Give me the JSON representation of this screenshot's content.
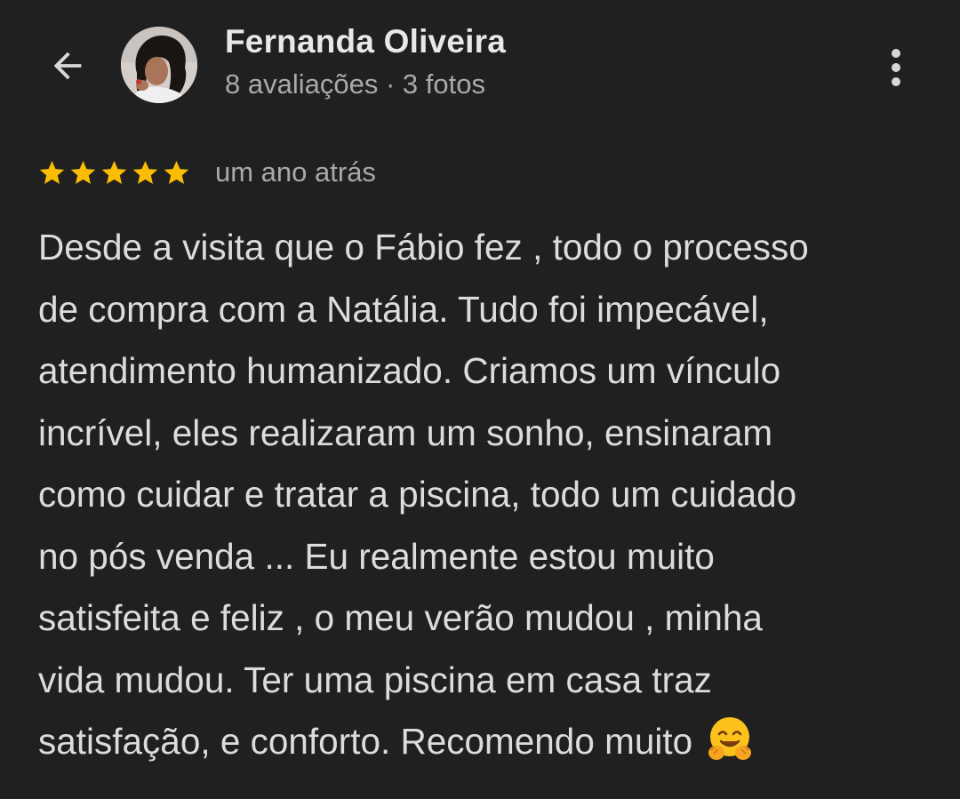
{
  "header": {
    "name": "Fernanda Oliveira",
    "subtitle": "8 avaliações · 3 fotos"
  },
  "icons": {
    "back": "arrow-back-icon",
    "more": "more-vertical-icon",
    "star": "star-icon",
    "emoji": "hugging-face-emoji"
  },
  "review": {
    "rating": 5,
    "rating_max": 5,
    "time": "um ano atrás",
    "lines": [
      "Desde a visita que o Fábio fez , todo o processo",
      "de compra com a Natália. Tudo foi impecável,",
      "atendimento humanizado. Criamos um vínculo",
      "incrível, eles realizaram um sonho, ensinaram",
      "como cuidar e tratar a piscina, todo um cuidado",
      "no pós venda ... Eu realmente estou muito",
      "satisfeita e feliz , o meu verão mudou , minha",
      "vida mudou. Ter uma piscina em casa traz",
      "satisfação, e conforto. Recomendo muito"
    ]
  },
  "colors": {
    "background": "#202020",
    "star": "#fbbc04",
    "text": "#dcdcdc",
    "secondary_text": "#a9a9a9"
  }
}
